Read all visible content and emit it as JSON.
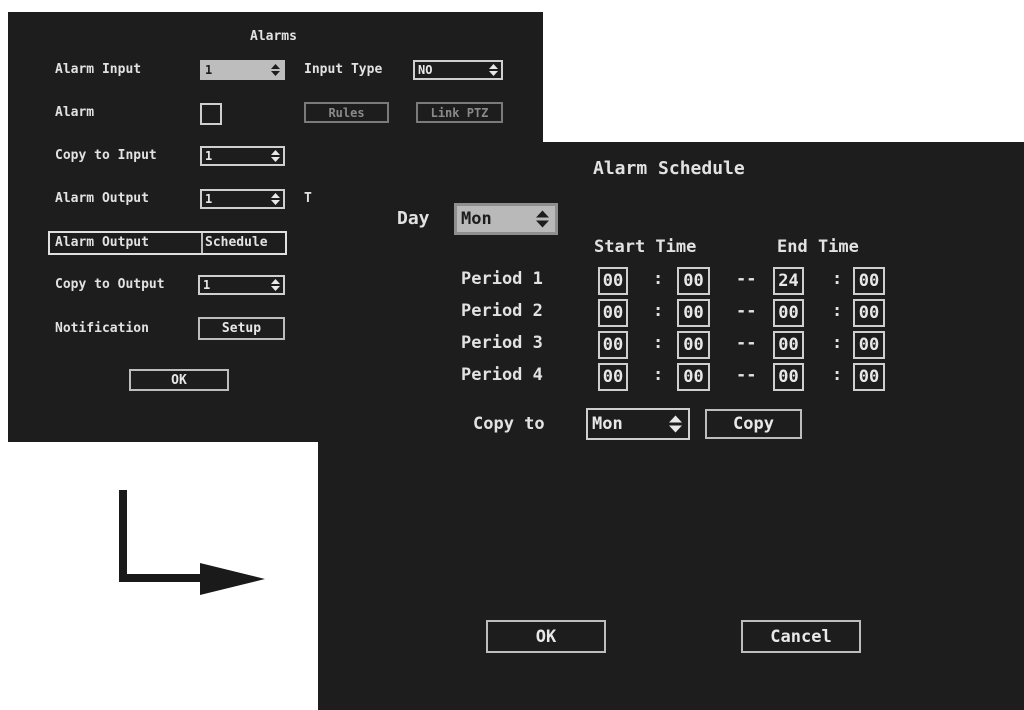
{
  "alarms": {
    "title": "Alarms",
    "alarm_input": {
      "label": "Alarm Input",
      "value": "1"
    },
    "input_type": {
      "label": "Input Type",
      "value": "NO"
    },
    "alarm": {
      "label": "Alarm"
    },
    "rules_btn": "Rules",
    "link_ptz_btn": "Link PTZ",
    "copy_to_input": {
      "label": "Copy to Input",
      "value": "1"
    },
    "alarm_output": {
      "label": "Alarm Output",
      "value": "1",
      "side_label": "T"
    },
    "schedule_row": {
      "label": "Alarm Output",
      "button": "Schedule"
    },
    "copy_to_output": {
      "label": "Copy to Output",
      "value": "1"
    },
    "notification": {
      "label": "Notification",
      "button": "Setup"
    },
    "ok_btn": "OK"
  },
  "schedule": {
    "title": "Alarm Schedule",
    "day_label": "Day",
    "day_value": "Mon",
    "start_header": "Start Time",
    "end_header": "End Time",
    "periods": [
      {
        "label": "Period 1",
        "start_h": "00",
        "start_m": "00",
        "end_h": "24",
        "end_m": "00"
      },
      {
        "label": "Period 2",
        "start_h": "00",
        "start_m": "00",
        "end_h": "00",
        "end_m": "00"
      },
      {
        "label": "Period 3",
        "start_h": "00",
        "start_m": "00",
        "end_h": "00",
        "end_m": "00"
      },
      {
        "label": "Period 4",
        "start_h": "00",
        "start_m": "00",
        "end_h": "00",
        "end_m": "00"
      }
    ],
    "sep_colon": ":",
    "sep_dash": "--",
    "copy_to_label": "Copy to",
    "copy_to_value": "Mon",
    "copy_btn": "Copy",
    "ok_btn": "OK",
    "cancel_btn": "Cancel"
  },
  "colors": {
    "panel_bg": "#1d1d1d",
    "text": "#e2e2e2",
    "border": "#cfcfcf",
    "arrow": "#1a1a1a"
  },
  "icons": {
    "spinner": "up-down-spinner-icon",
    "arrow": "elbow-arrow-icon"
  }
}
